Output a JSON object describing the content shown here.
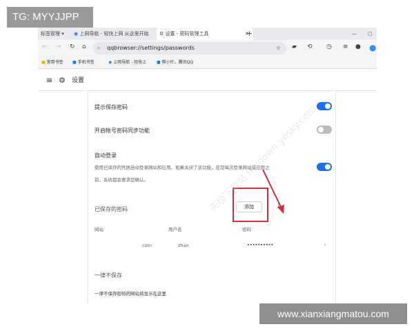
{
  "overlay_label": "TG: MYYJJPP",
  "footer_watermark": "www.xianxiangmatou.com",
  "browser": {
    "tabs": [
      {
        "label": "标签管理 ▾"
      },
      {
        "label": "上网导航 - 轻快上网 从这里开始"
      },
      {
        "label": "设置 - 密码管理工具",
        "active": true
      }
    ],
    "url": "qqbrowser://settings/passwords",
    "bookmarks": [
      "常用书签",
      "手机书签",
      "上网导航 - 轻快上",
      "帮小忙，腾讯QQ"
    ]
  },
  "settings": {
    "title": "设置",
    "offer_save_label": "提示保存密码",
    "offer_save_on": true,
    "sync_label": "开启帐号密码同步功能",
    "sync_on": false,
    "autologin_label": "自动登录",
    "autologin_desc1": "使用已保存的凭据自动登录网站和应用。如果关闭了该功能，在您每次登录网站或应用之",
    "autologin_desc2": "前，系统都会要求您确认。",
    "autologin_on": true,
    "saved_title": "已保存的密码",
    "add_label": "添加",
    "columns": [
      "网站",
      "用户名",
      "密码"
    ],
    "rows": [
      {
        "site": ".com",
        "user": "zhan",
        "password": "••••••••••"
      }
    ],
    "never_title": "一律不保存",
    "never_desc": "一律不保存密码的网站将显示在这里"
  },
  "image_watermark": "天极下载站 mydown.yesky.com",
  "colors": {
    "accent": "#1f6fe8",
    "annotation": "#d42a3a"
  }
}
